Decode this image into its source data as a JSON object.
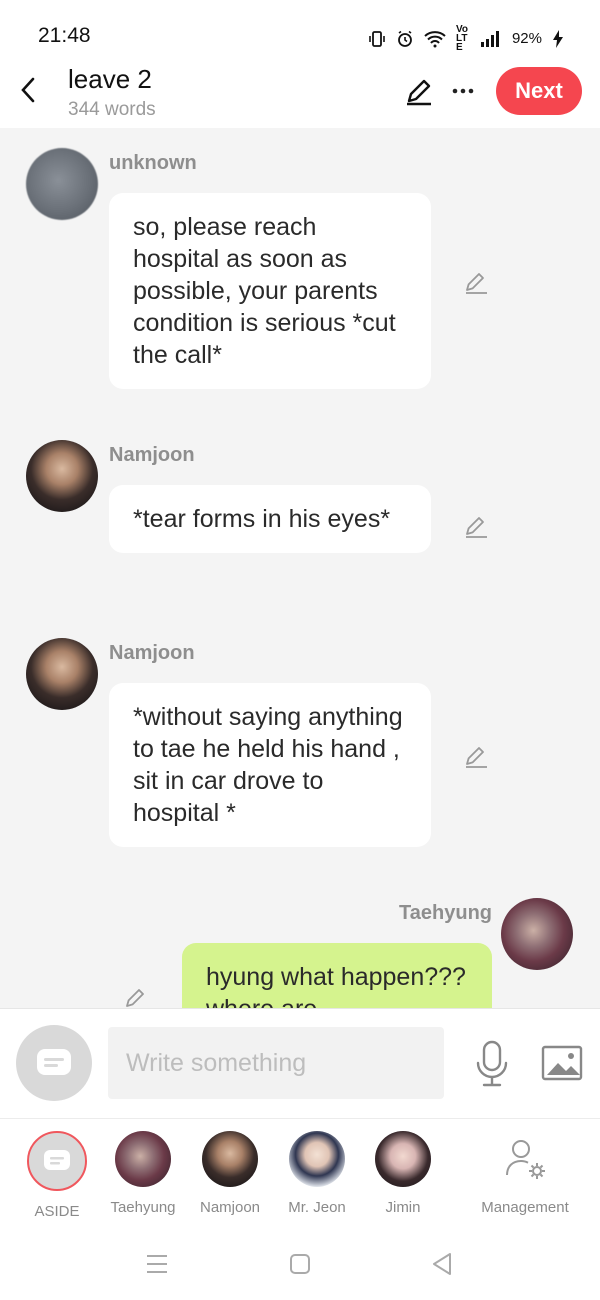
{
  "status": {
    "time": "21:48",
    "battery": "92%",
    "network_label": "Vo LTE"
  },
  "header": {
    "title": "leave 2",
    "subtitle": "344 words",
    "next_label": "Next"
  },
  "messages": [
    {
      "sender": "unknown",
      "text": "so, please reach hospital as soon as possible, your parents condition is serious *cut the call*"
    },
    {
      "sender": "Namjoon",
      "text": "*tear forms in his eyes*"
    },
    {
      "sender": "Namjoon",
      "text": "*without saying anything to tae he held his hand , sit in car drove to hospital *"
    },
    {
      "sender": "Taehyung",
      "text": "hyung what happen??? where are"
    }
  ],
  "input": {
    "placeholder": "Write something"
  },
  "characters": [
    {
      "label": "ASIDE"
    },
    {
      "label": "Taehyung"
    },
    {
      "label": "Namjoon"
    },
    {
      "label": "Mr. Jeon"
    },
    {
      "label": "Jimin"
    },
    {
      "label": "Management"
    }
  ],
  "colors": {
    "accent": "#f5464f",
    "user_bubble": "#d5f38e",
    "background": "#f4f4f4"
  },
  "icons": [
    "back-arrow-icon",
    "pencil-icon",
    "more-icon",
    "mic-icon",
    "image-icon",
    "aside-icon",
    "manage-user-icon"
  ]
}
